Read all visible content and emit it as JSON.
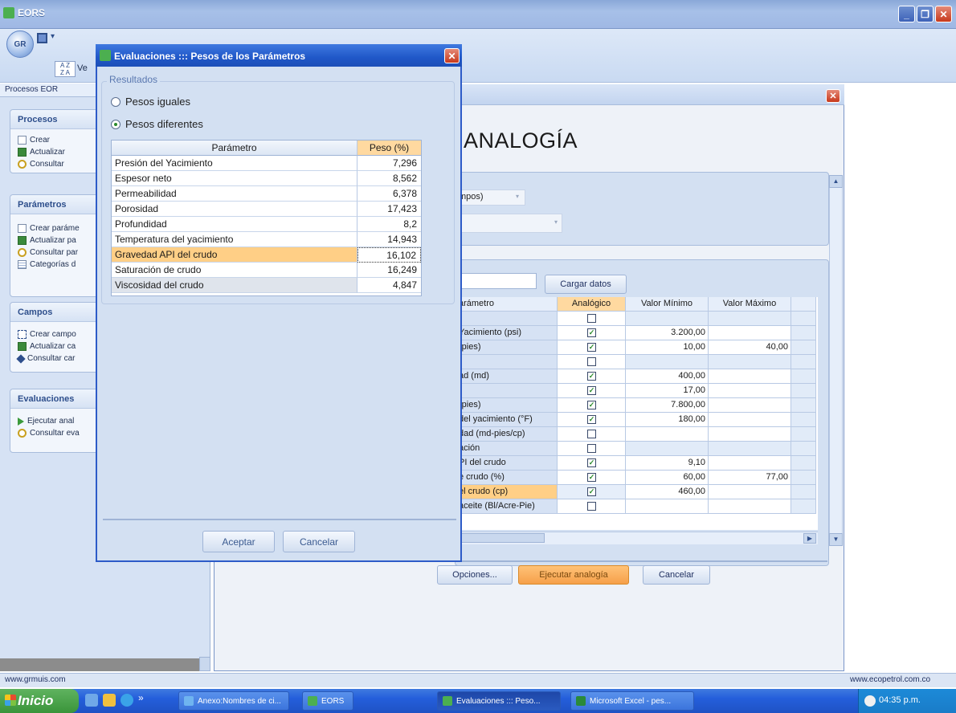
{
  "app": {
    "title": "EORS",
    "ribbon_label": "Ve",
    "orb_text": "GR",
    "qat_more": "▾"
  },
  "nav": {
    "header": "Procesos EOR",
    "groups": [
      {
        "title": "Procesos",
        "items": [
          "Crear",
          "Actualizar",
          "Consultar"
        ]
      },
      {
        "title": "Parámetros",
        "items": [
          "Crear paráme",
          "Actualizar pa",
          "Consultar par",
          "Categorías d"
        ]
      },
      {
        "title": "Campos",
        "items": [
          "Crear campo",
          "Actualizar ca",
          "Consultar car"
        ]
      },
      {
        "title": "Evaluaciones",
        "items": [
          "Ejecutar anal",
          "Consultar eva"
        ]
      }
    ]
  },
  "status": {
    "left": "www.grmuis.com",
    "right": "www.ecopetrol.com.co"
  },
  "analogy_window": {
    "heading": "ANALOGÍA",
    "combo1_value": "mpos)",
    "load_button": "Cargar datos",
    "columns": {
      "param": "arámetro",
      "analog": "Analógico",
      "min": "Valor Mínimo",
      "max": "Valor Máximo"
    },
    "rows": [
      {
        "param": "",
        "checked": false,
        "min": "",
        "max": ""
      },
      {
        "param": "Yacimiento (psi)",
        "checked": true,
        "min": "3.200,00",
        "max": ""
      },
      {
        "param": "(pies)",
        "checked": true,
        "min": "10,00",
        "max": "40,00"
      },
      {
        "param": "",
        "checked": false,
        "min": "",
        "max": ""
      },
      {
        "param": "ad (md)",
        "checked": true,
        "min": "400,00",
        "max": ""
      },
      {
        "param": "",
        "checked": true,
        "min": "17,00",
        "max": ""
      },
      {
        "param": "(pies)",
        "checked": true,
        "min": "7.800,00",
        "max": ""
      },
      {
        "param": "del yacimiento (°F)",
        "checked": true,
        "min": "180,00",
        "max": ""
      },
      {
        "param": "dad (md-pies/cp)",
        "checked": false,
        "min": "",
        "max": ""
      },
      {
        "param": "ación",
        "checked": false,
        "min": "",
        "max": ""
      },
      {
        "param": "PI del crudo",
        "checked": true,
        "min": "9,10",
        "max": ""
      },
      {
        "param": "e crudo (%)",
        "checked": true,
        "min": "60,00",
        "max": "77,00"
      },
      {
        "param": "el crudo (cp)",
        "checked": true,
        "min": "460,00",
        "max": ""
      },
      {
        "param": "aceite (Bl/Acre-Pie)",
        "checked": false,
        "min": "",
        "max": ""
      }
    ],
    "buttons": {
      "options": "Opciones...",
      "run": "Ejecutar analogía",
      "cancel": "Cancelar"
    }
  },
  "dialog": {
    "title": "Evaluaciones ::: Pesos de los Parámetros",
    "group_label": "Resultados",
    "radio_equal": "Pesos iguales",
    "radio_diff": "Pesos diferentes",
    "selected_radio": "Pesos diferentes",
    "columns": {
      "param": "Parámetro",
      "weight": "Peso (%)"
    },
    "rows": [
      {
        "param": "Presión del Yacimiento",
        "weight": "7,296"
      },
      {
        "param": "Espesor neto",
        "weight": "8,562"
      },
      {
        "param": "Permeabilidad",
        "weight": "6,378"
      },
      {
        "param": "Porosidad",
        "weight": "17,423"
      },
      {
        "param": "Profundidad",
        "weight": "8,2"
      },
      {
        "param": "Temperatura del yacimiento",
        "weight": "14,943"
      },
      {
        "param": "Gravedad API del crudo",
        "weight": "16,102"
      },
      {
        "param": "Saturación de crudo",
        "weight": "16,249"
      },
      {
        "param": "Viscosidad del crudo",
        "weight": "4,847"
      }
    ],
    "accept": "Aceptar",
    "cancel": "Cancelar"
  },
  "taskbar": {
    "start": "Inicio",
    "quicklaunch_more": "»",
    "buttons": [
      "Anexo:Nombres de ci...",
      "EORS",
      "Evaluaciones ::: Peso...",
      "Microsoft Excel - pes..."
    ],
    "clock": "04:35 p.m."
  },
  "colors": {
    "title_blue": "#2057c8",
    "highlight_orange": "#ffcf86",
    "panel_blue": "#d3e0f2",
    "run_button": "#f6a04a"
  }
}
